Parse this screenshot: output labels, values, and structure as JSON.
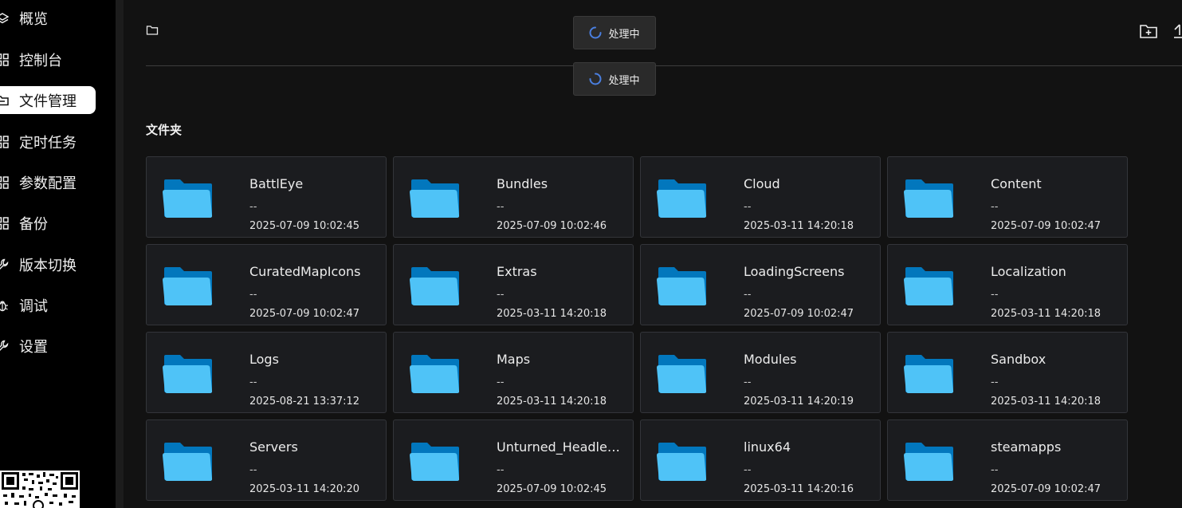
{
  "sidebar": {
    "items": [
      {
        "label": "概览",
        "icon": "layers-icon"
      },
      {
        "label": "控制台",
        "icon": "grid-icon"
      },
      {
        "label": "文件管理",
        "icon": "folder-icon"
      },
      {
        "label": "定时任务",
        "icon": "grid-icon"
      },
      {
        "label": "参数配置",
        "icon": "grid-icon"
      },
      {
        "label": "备份",
        "icon": "grid-icon"
      },
      {
        "label": "版本切换",
        "icon": "wrench-icon"
      },
      {
        "label": "调试",
        "icon": "bug-icon"
      },
      {
        "label": "设置",
        "icon": "wrench-icon"
      }
    ],
    "active_index": 2
  },
  "toasts": [
    {
      "label": "处理中"
    },
    {
      "label": "处理中"
    }
  ],
  "section": {
    "title": "文件夹"
  },
  "folders": [
    {
      "name": "BattlEye",
      "size": "--",
      "date": "2025-07-09 10:02:45"
    },
    {
      "name": "Bundles",
      "size": "--",
      "date": "2025-07-09 10:02:46"
    },
    {
      "name": "Cloud",
      "size": "--",
      "date": "2025-03-11 14:20:18"
    },
    {
      "name": "Content",
      "size": "--",
      "date": "2025-07-09 10:02:47"
    },
    {
      "name": "CuratedMapIcons",
      "size": "--",
      "date": "2025-07-09 10:02:47"
    },
    {
      "name": "Extras",
      "size": "--",
      "date": "2025-03-11 14:20:18"
    },
    {
      "name": "LoadingScreens",
      "size": "--",
      "date": "2025-07-09 10:02:47"
    },
    {
      "name": "Localization",
      "size": "--",
      "date": "2025-03-11 14:20:18"
    },
    {
      "name": "Logs",
      "size": "--",
      "date": "2025-08-21 13:37:12"
    },
    {
      "name": "Maps",
      "size": "--",
      "date": "2025-03-11 14:20:18"
    },
    {
      "name": "Modules",
      "size": "--",
      "date": "2025-03-11 14:20:19"
    },
    {
      "name": "Sandbox",
      "size": "--",
      "date": "2025-03-11 14:20:18"
    },
    {
      "name": "Servers",
      "size": "--",
      "date": "2025-03-11 14:20:20"
    },
    {
      "name": "Unturned_Headle…",
      "size": "--",
      "date": "2025-07-09 10:02:45"
    },
    {
      "name": "linux64",
      "size": "--",
      "date": "2025-03-11 14:20:16"
    },
    {
      "name": "steamapps",
      "size": "--",
      "date": "2025-07-09 10:02:47"
    }
  ],
  "colors": {
    "folder_front": "#4fc3f7",
    "folder_back": "#0277bd",
    "spinner": "#4a7fe0"
  }
}
